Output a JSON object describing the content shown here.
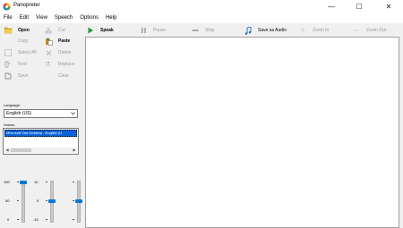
{
  "window": {
    "title": "Panopreter",
    "minimize_glyph": "—",
    "maximize_glyph": "☐",
    "close_glyph": "✕"
  },
  "menu": [
    "File",
    "Edit",
    "View",
    "Speech",
    "Options",
    "Help"
  ],
  "left_toolbar": {
    "open": "Open",
    "cut": "Cut",
    "copy": "Copy",
    "paste": "Paste",
    "select_all": "Select All",
    "delete": "Delete",
    "find": "Find",
    "replace": "Replace",
    "save": "Save",
    "clear": "Clear"
  },
  "speech_toolbar": {
    "speak": "Speak",
    "pause": "Pause",
    "stop": "Stop",
    "save_as_audio": "Save as Audio",
    "zoom_in": "Zoom In",
    "zoom_out": "Zoom Out"
  },
  "language": {
    "label": "Language:",
    "selected": "English (US)"
  },
  "voices": {
    "label": "Voices:",
    "selected": "Microsoft Zira Desktop - English (U"
  },
  "sliders": [
    {
      "name": "speed",
      "top_label": "100",
      "mid_label": "50",
      "bottom_label": "0",
      "value": 100
    },
    {
      "name": "pitch",
      "top_label": "10",
      "mid_label": "0",
      "bottom_label": "-10",
      "value": 0
    },
    {
      "name": "volume",
      "top_label": "",
      "mid_label": "",
      "bottom_label": "",
      "value": 50
    }
  ],
  "colors": {
    "accent": "#0078d7",
    "speak_green": "#1a9c3a",
    "selection": "#0a64d8",
    "disabled_text": "#9a9a9a"
  }
}
